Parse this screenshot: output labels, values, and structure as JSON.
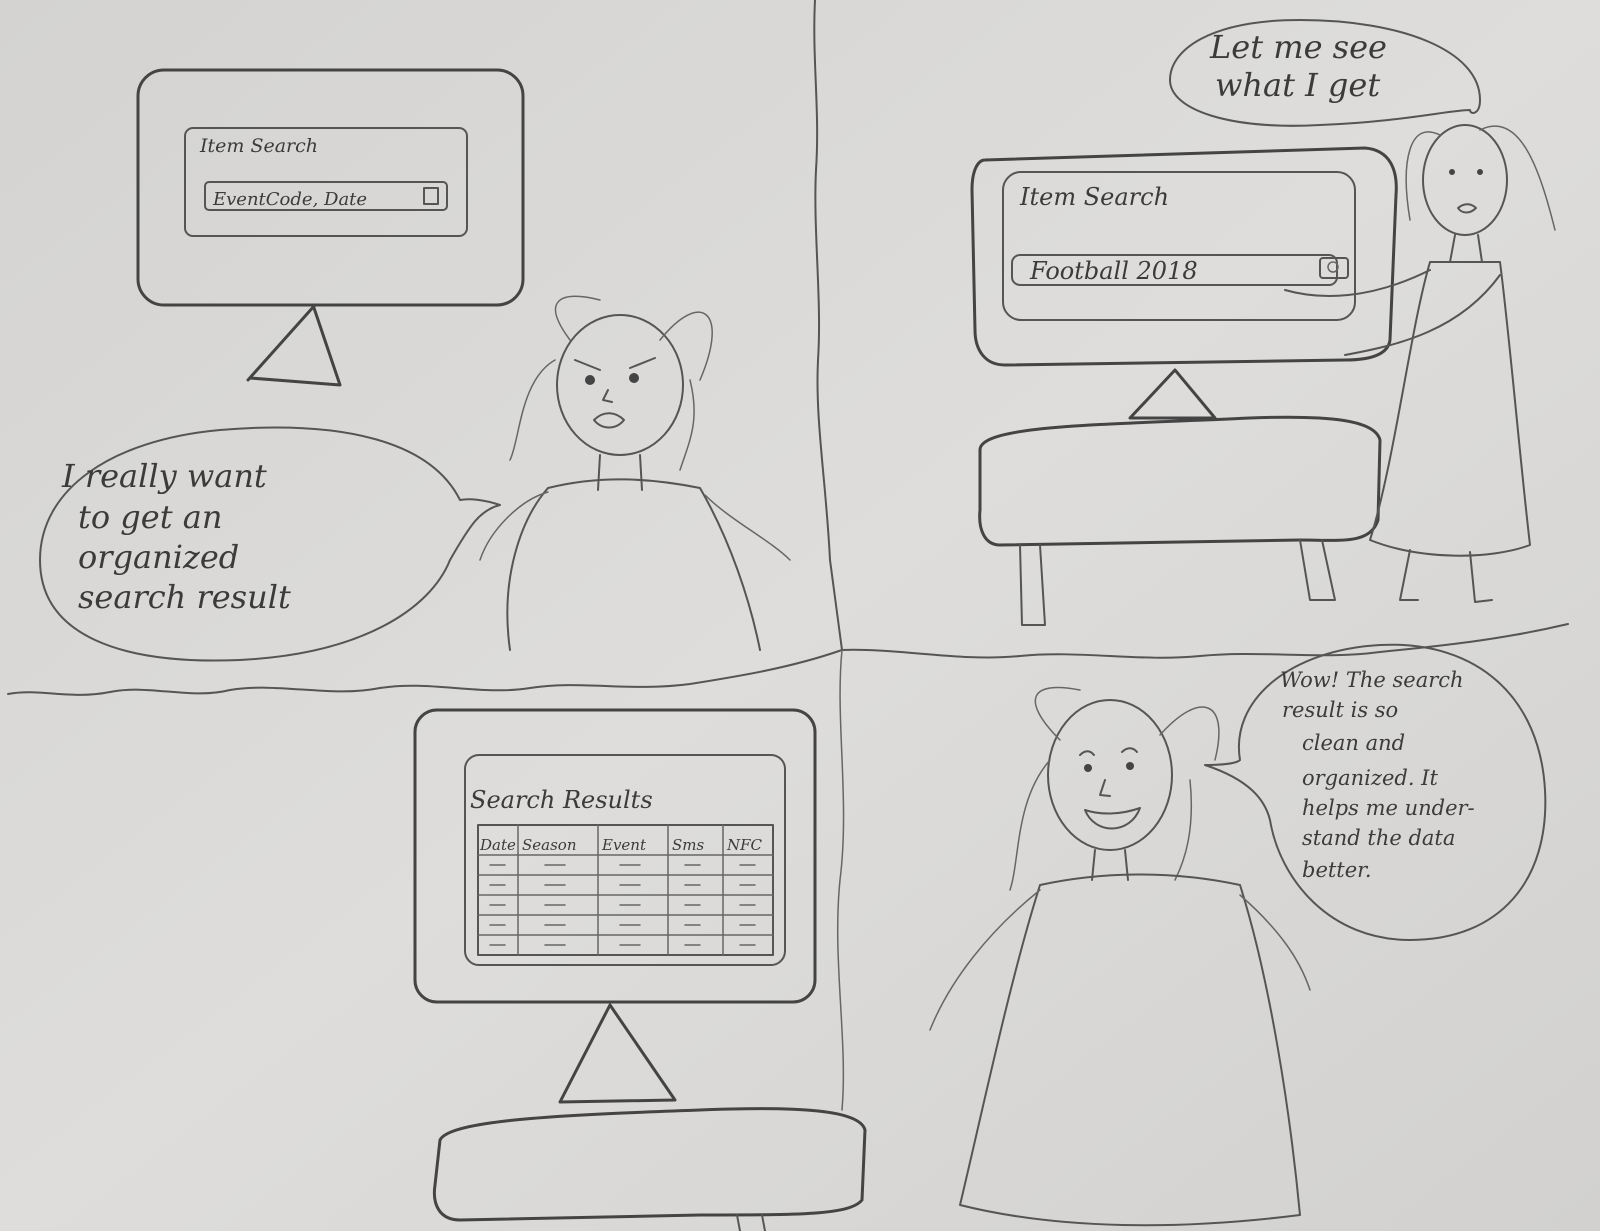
{
  "panel1": {
    "screen_title": "Item Search",
    "search_placeholder": "EventCode, Date",
    "speech": [
      "I really want",
      "to get an",
      "organized",
      "search result"
    ]
  },
  "panel2": {
    "screen_title": "Item Search",
    "search_value": "Football 2018",
    "speech": [
      "Let me see",
      "what I get"
    ]
  },
  "panel3": {
    "screen_title": "Search Results",
    "table_headers": [
      "Date",
      "Season",
      "Event",
      "Sms",
      "NFC"
    ]
  },
  "panel4": {
    "speech": [
      "Wow! The search",
      "result is so",
      "clean and",
      "organized. It",
      "helps me under-",
      "stand the data",
      "better."
    ]
  },
  "colors": {
    "paper": "#d9d8d6",
    "pencil": "#444444"
  }
}
